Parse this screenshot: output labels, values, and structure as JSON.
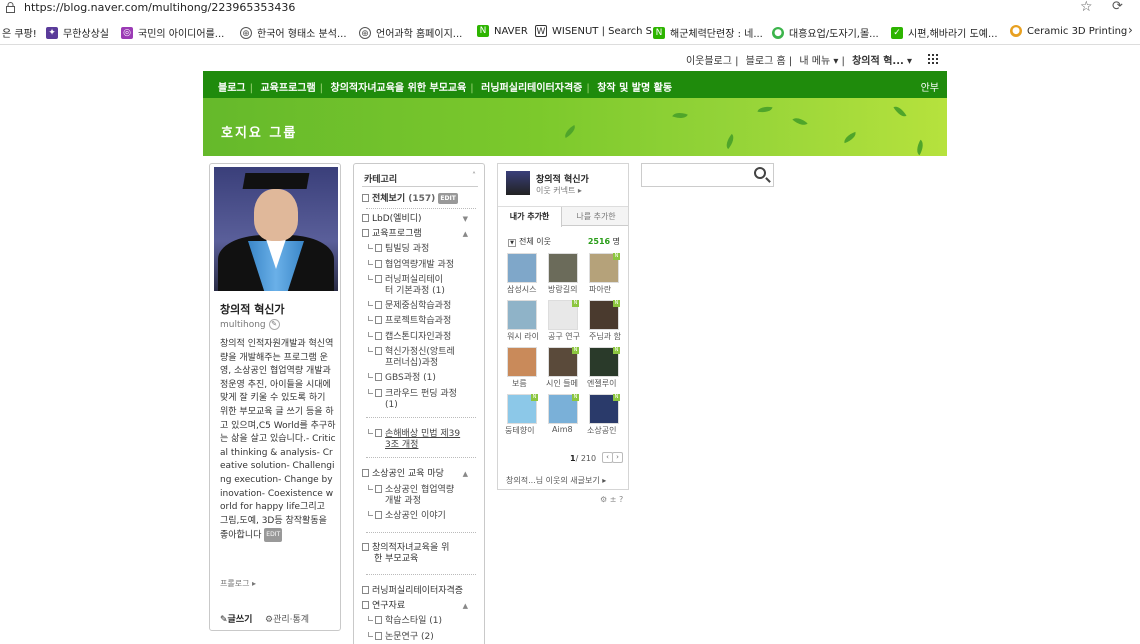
{
  "browser": {
    "url": "https://blog.naver.com/multihong/223965353436",
    "bookmarks": [
      {
        "label": "은 쿠팡!",
        "icon": "",
        "color": "#fff"
      },
      {
        "label": "무한상상실",
        "icon": "star-icon",
        "color": "#5a3b9a"
      },
      {
        "label": "국민의 아이디어를...",
        "icon": "idea-icon",
        "color": "#9b3bb5"
      },
      {
        "label": "한국어 형태소 분석...",
        "icon": "globe-icon",
        "color": "#555"
      },
      {
        "label": "언어과학 홈페이지...",
        "icon": "globe-icon",
        "color": "#555"
      },
      {
        "label": "NAVER",
        "icon": "naver-icon",
        "color": "#2db400"
      },
      {
        "label": "WISENUT | Search S...",
        "icon": "wisenut-icon",
        "color": "#333"
      },
      {
        "label": "해군체력단련장 : 네...",
        "icon": "naver-icon",
        "color": "#2db400"
      },
      {
        "label": "대흥요업/도자기,몰...",
        "icon": "leaf-icon",
        "color": "#3cb44b"
      },
      {
        "label": "시편,해바라기 도예...",
        "icon": "page-icon",
        "color": "#2db400"
      },
      {
        "label": "Ceramic 3D Printing",
        "icon": "ceramic-icon",
        "color": "#e8a020"
      }
    ]
  },
  "topnav": {
    "items": [
      "이웃블로그",
      "블로그 홈",
      "내 메뉴 ▾",
      "창의적 혁..."
    ]
  },
  "blog": {
    "menu": [
      "블로그",
      "교육프로그램",
      "창의적자녀교육을 위한 부모교육",
      "러닝퍼실리테이터자격증",
      "창작 및 발명 활동"
    ],
    "menu_right": "안부",
    "title": "호지요 그룹"
  },
  "profile": {
    "name": "창의적 혁신가",
    "id": "multihong",
    "desc": "창의적 인적자원개발과 혁신역량을 개발해주는 프로그램 운영, 소상공인 협업역량 개발과정운영 추진, 아이들을 시대에 맞게 잘 키울 수 있도록 하기 위한 부모교육 글 쓰기 등을 하고 있으며,C5 World를 추구하는 삶을 살고 있습니다.- Critical thinking & analysis- Creative solution- Challenging execution- Change by inovation- Coexistence world for happy life그리고 그림,도예, 3D등 창작활동을 좋아합니다",
    "edit": "EDIT",
    "prologue": "프롤로그 ▸",
    "write": "✎글쓰기",
    "admin": "⚙관리·통계"
  },
  "category": {
    "header": "카테고리",
    "all_label": "전체보기",
    "all_count": "(157)",
    "items": [
      "LbD(엘비디)",
      "교육프로그램",
      "팀빌딩 과정",
      "협업역량개발 과정",
      "러닝퍼실리테이",
      "터 기본과정 (1)",
      "문제중심학습과정",
      "프로젝트학습과정",
      "캡스톤디자인과정",
      "혁신가정신(앙트레",
      "프러너십)과정",
      "GBS과정 (1)",
      "크라우드 펀딩 과정",
      "(1)",
      "손해배상 민법 제39",
      "3조 개정",
      "소상공인 교육 마당",
      "소상공인 협업역량",
      "개발 과정",
      "소상공인 이야기",
      "창의적자녀교육을 위",
      "한 부모교육",
      "러닝퍼실리테이터자격증",
      "연구자료",
      "학습스타일 (1)",
      "논문연구 (2)"
    ]
  },
  "neighbor": {
    "name": "창의적 혁신가",
    "sub": "이웃 커넥트 ▸",
    "tab1": "내가 추가한",
    "tab2": "나를 추가한",
    "all_label": "전체 이웃",
    "count": "2516",
    "count_unit": "명",
    "thumbs": [
      {
        "label": "삼성시스",
        "color": "#7fa7c9"
      },
      {
        "label": "방랑길의",
        "color": "#6b6b5a"
      },
      {
        "label": "파아란",
        "color": "#b5a27a"
      },
      {
        "label": "워시 라이",
        "color": "#8fb3c8"
      },
      {
        "label": "공구 연구",
        "color": "#e8e8e8"
      },
      {
        "label": "주님과 함",
        "color": "#4a3a2e"
      },
      {
        "label": "보름",
        "color": "#c98a5a"
      },
      {
        "label": "시인 들메",
        "color": "#5a4a3a"
      },
      {
        "label": "엔젤루이",
        "color": "#2a3a2a"
      },
      {
        "label": "둥테향이",
        "color": "#8cc8e8"
      },
      {
        "label": "Aim8",
        "color": "#7ab0d8"
      },
      {
        "label": "소상공인",
        "color": "#2a3a6a"
      }
    ],
    "page_current": "1",
    "page_total": "/ 210",
    "new_posts": "창의적...님 이웃의 새글보기 ▸",
    "tools": "⚙ ± ?"
  },
  "search": {
    "placeholder": ""
  }
}
